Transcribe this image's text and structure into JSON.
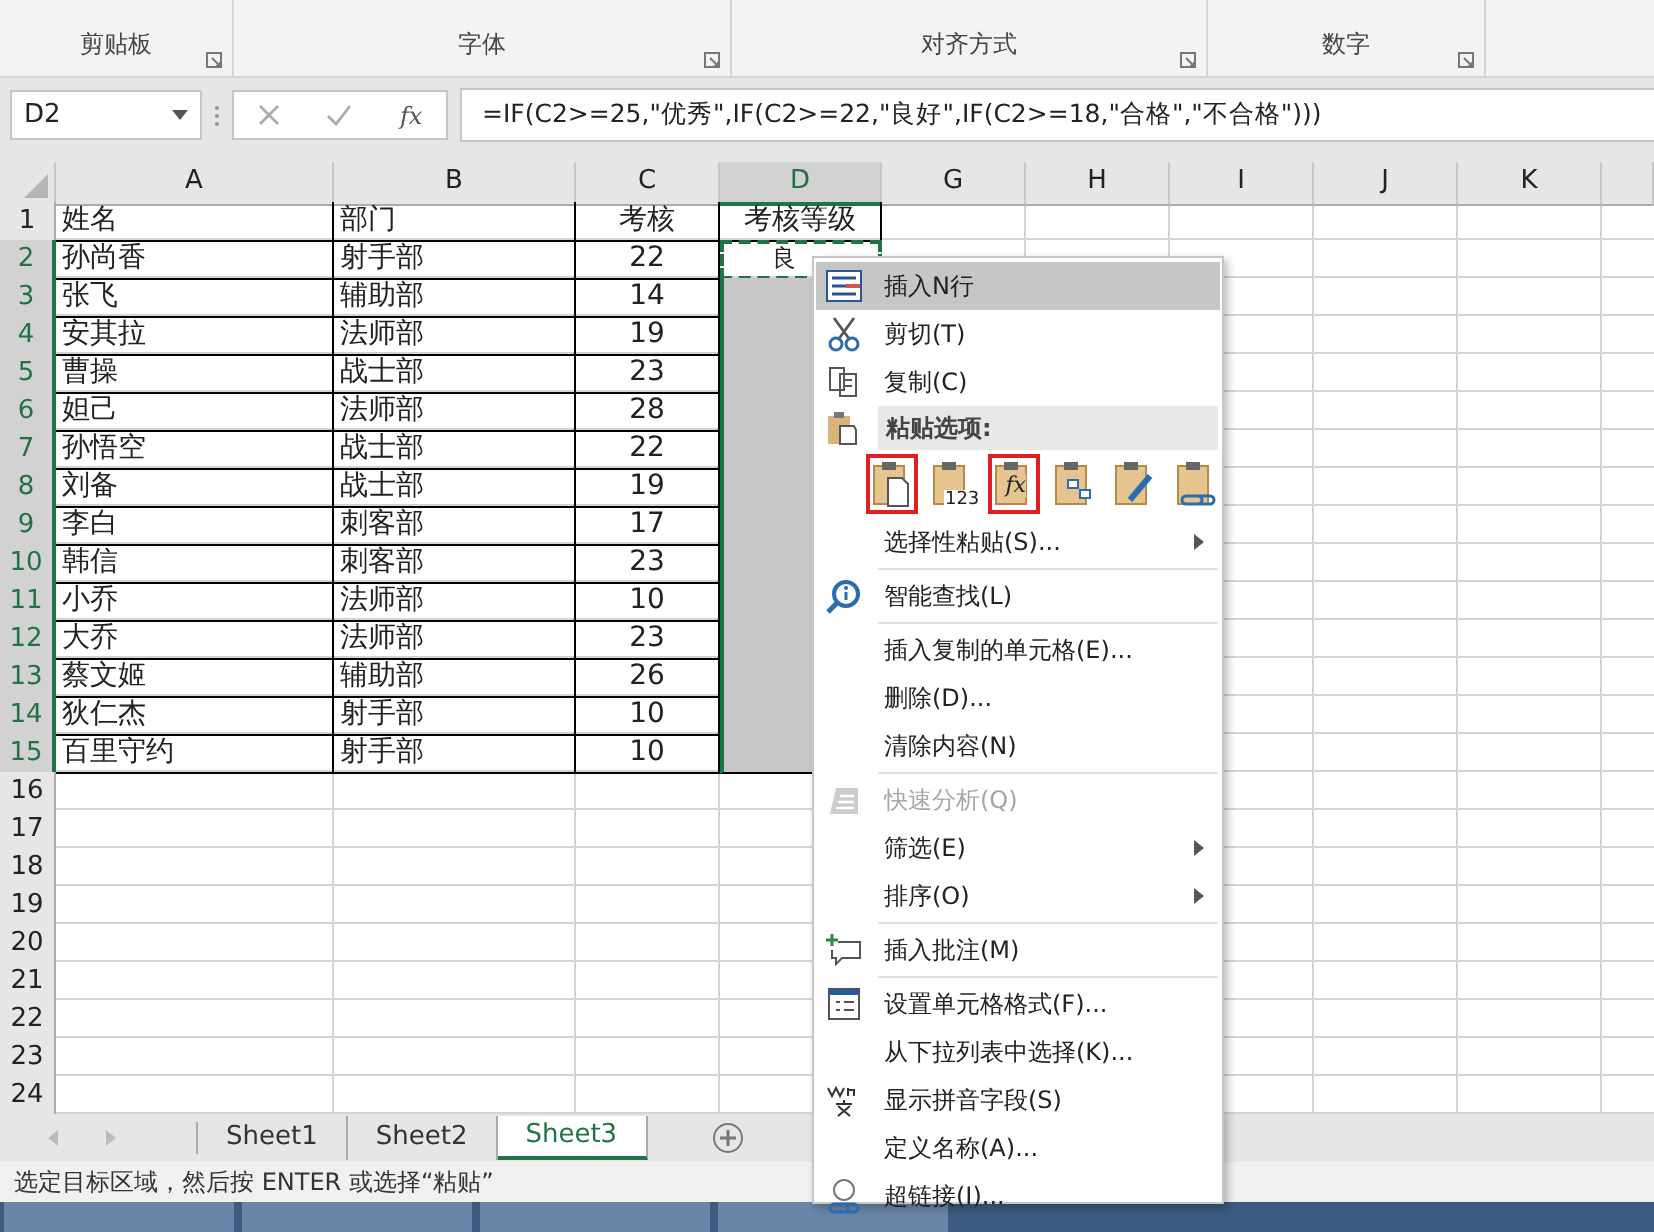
{
  "ribbon": {
    "groups": [
      {
        "label": "剪贴板"
      },
      {
        "label": "字体"
      },
      {
        "label": "对齐方式"
      },
      {
        "label": "数字"
      }
    ]
  },
  "formula_bar": {
    "name_box": "D2",
    "function_label": "fx",
    "formula": "=IF(C2>=25,\"优秀\",IF(C2>=22,\"良好\",IF(C2>=18,\"合格\",\"不合格\")))"
  },
  "columns": [
    {
      "label": "A",
      "selected": false
    },
    {
      "label": "B",
      "selected": false
    },
    {
      "label": "C",
      "selected": false
    },
    {
      "label": "D",
      "selected": true
    },
    {
      "label": "G",
      "selected": false
    },
    {
      "label": "H",
      "selected": false
    },
    {
      "label": "I",
      "selected": false
    },
    {
      "label": "J",
      "selected": false
    },
    {
      "label": "K",
      "selected": false
    }
  ],
  "rows": [
    {
      "number": "1",
      "cells": [
        "姓名",
        "部门",
        "考核",
        "考核等级"
      ],
      "selected": false,
      "active": false
    },
    {
      "number": "2",
      "cells": [
        "孙尚香",
        "射手部",
        "22",
        "良"
      ],
      "selected": true,
      "active": true
    },
    {
      "number": "3",
      "cells": [
        "张飞",
        "辅助部",
        "14"
      ],
      "selected": true,
      "active": false
    },
    {
      "number": "4",
      "cells": [
        "安其拉",
        "法师部",
        "19"
      ],
      "selected": true,
      "active": false
    },
    {
      "number": "5",
      "cells": [
        "曹操",
        "战士部",
        "23"
      ],
      "selected": true,
      "active": false
    },
    {
      "number": "6",
      "cells": [
        "妲己",
        "法师部",
        "28"
      ],
      "selected": true,
      "active": false
    },
    {
      "number": "7",
      "cells": [
        "孙悟空",
        "战士部",
        "22"
      ],
      "selected": true,
      "active": false
    },
    {
      "number": "8",
      "cells": [
        "刘备",
        "战士部",
        "19"
      ],
      "selected": true,
      "active": false
    },
    {
      "number": "9",
      "cells": [
        "李白",
        "刺客部",
        "17"
      ],
      "selected": true,
      "active": false
    },
    {
      "number": "10",
      "cells": [
        "韩信",
        "刺客部",
        "23"
      ],
      "selected": true,
      "active": false
    },
    {
      "number": "11",
      "cells": [
        "小乔",
        "法师部",
        "10"
      ],
      "selected": true,
      "active": false
    },
    {
      "number": "12",
      "cells": [
        "大乔",
        "法师部",
        "23"
      ],
      "selected": true,
      "active": false
    },
    {
      "number": "13",
      "cells": [
        "蔡文姬",
        "辅助部",
        "26"
      ],
      "selected": true,
      "active": false
    },
    {
      "number": "14",
      "cells": [
        "狄仁杰",
        "射手部",
        "10"
      ],
      "selected": true,
      "active": false
    },
    {
      "number": "15",
      "cells": [
        "百里守约",
        "射手部",
        "10"
      ],
      "selected": true,
      "active": false
    },
    {
      "number": "16",
      "selected": false,
      "active": false
    },
    {
      "number": "17",
      "selected": false,
      "active": false
    },
    {
      "number": "18",
      "selected": false,
      "active": false
    },
    {
      "number": "19",
      "selected": false,
      "active": false
    },
    {
      "number": "20",
      "selected": false,
      "active": false
    },
    {
      "number": "21",
      "selected": false,
      "active": false
    },
    {
      "number": "22",
      "selected": false,
      "active": false
    },
    {
      "number": "23",
      "selected": false,
      "active": false
    },
    {
      "number": "24",
      "selected": false,
      "active": false
    }
  ],
  "context_menu": {
    "items": [
      {
        "kind": "item",
        "label": "插入N行",
        "highlighted": true,
        "disabled": false,
        "submenu": false
      },
      {
        "kind": "item",
        "label": "剪切(T)",
        "highlighted": false,
        "disabled": false,
        "submenu": false
      },
      {
        "kind": "item",
        "label": "复制(C)",
        "highlighted": false,
        "disabled": false,
        "submenu": false
      },
      {
        "kind": "header",
        "label": "粘贴选项:"
      },
      {
        "kind": "paste_options",
        "options": [
          {
            "framed": true
          },
          {
            "badge": "123",
            "framed": false
          },
          {
            "badge": "fx",
            "framed": true
          },
          {
            "framed": false
          },
          {
            "framed": false
          },
          {
            "framed": false
          }
        ]
      },
      {
        "kind": "item",
        "label": "选择性粘贴(S)...",
        "highlighted": false,
        "disabled": false,
        "submenu": true
      },
      {
        "kind": "separator"
      },
      {
        "kind": "item",
        "label": "智能查找(L)",
        "highlighted": false,
        "disabled": false,
        "submenu": false
      },
      {
        "kind": "separator"
      },
      {
        "kind": "item",
        "label": "插入复制的单元格(E)...",
        "highlighted": false,
        "disabled": false,
        "submenu": false
      },
      {
        "kind": "item",
        "label": "删除(D)...",
        "highlighted": false,
        "disabled": false,
        "submenu": false
      },
      {
        "kind": "item",
        "label": "清除内容(N)",
        "highlighted": false,
        "disabled": false,
        "submenu": false
      },
      {
        "kind": "separator"
      },
      {
        "kind": "item",
        "label": "快速分析(Q)",
        "highlighted": false,
        "disabled": true,
        "submenu": false
      },
      {
        "kind": "item",
        "label": "筛选(E)",
        "highlighted": false,
        "disabled": false,
        "submenu": true
      },
      {
        "kind": "item",
        "label": "排序(O)",
        "highlighted": false,
        "disabled": false,
        "submenu": true
      },
      {
        "kind": "separator"
      },
      {
        "kind": "item",
        "label": "插入批注(M)",
        "highlighted": false,
        "disabled": false,
        "submenu": false
      },
      {
        "kind": "separator"
      },
      {
        "kind": "item",
        "label": "设置单元格格式(F)...",
        "highlighted": false,
        "disabled": false,
        "submenu": false
      },
      {
        "kind": "item",
        "label": "从下拉列表中选择(K)...",
        "highlighted": false,
        "disabled": false,
        "submenu": false
      },
      {
        "kind": "item",
        "label": "显示拼音字段(S)",
        "highlighted": false,
        "disabled": false,
        "submenu": false
      },
      {
        "kind": "item",
        "label": "定义名称(A)...",
        "highlighted": false,
        "disabled": false,
        "submenu": false
      },
      {
        "kind": "item",
        "label": "超链接(I)...",
        "highlighted": false,
        "disabled": false,
        "submenu": false
      }
    ]
  },
  "sheet_tabs": [
    {
      "label": "Sheet1",
      "selected": false
    },
    {
      "label": "Sheet2",
      "selected": false
    },
    {
      "label": "Sheet3",
      "selected": true
    }
  ],
  "status_bar": "选定目标区域，然后按 ENTER 或选择“粘贴”"
}
